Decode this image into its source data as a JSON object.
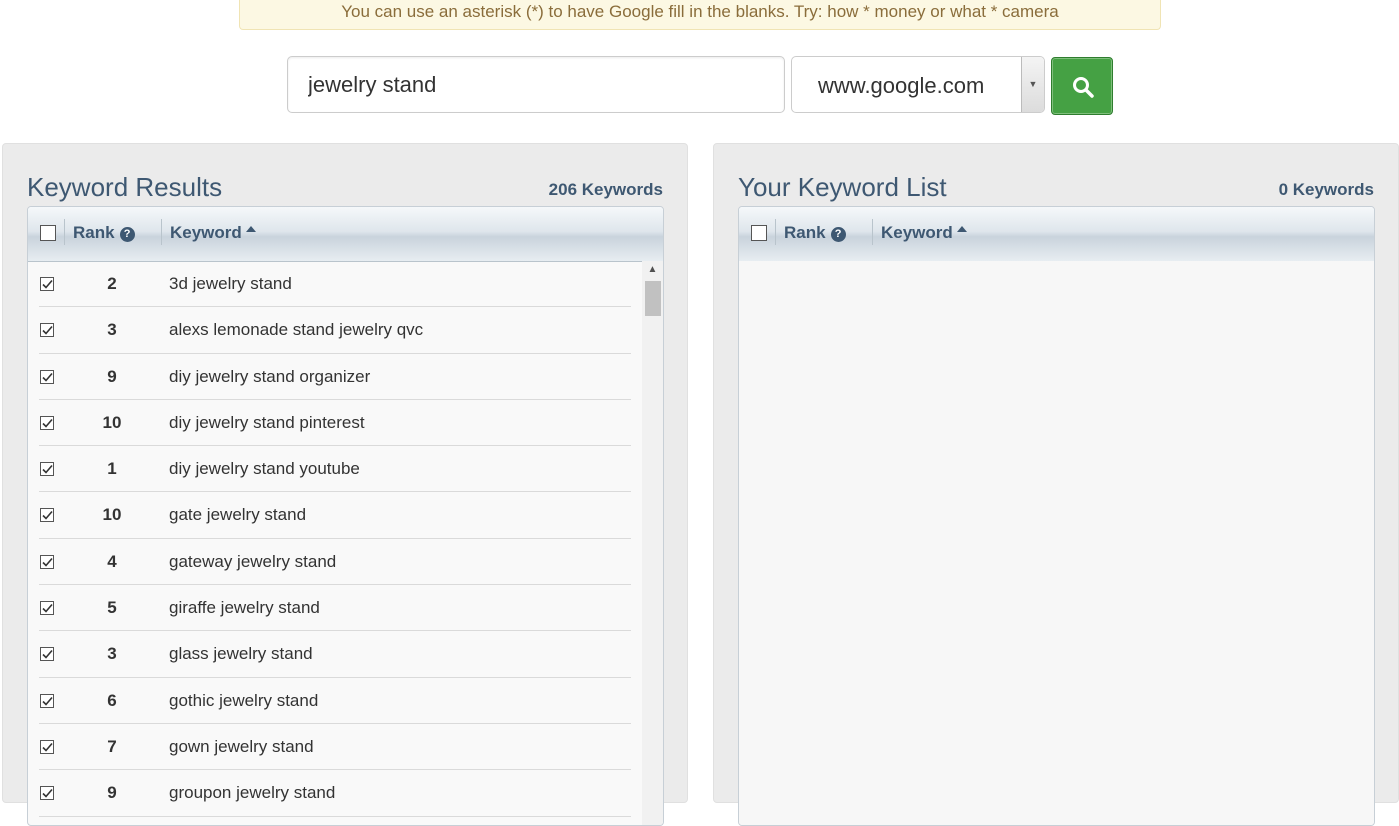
{
  "tip": {
    "text": "You can use an asterisk (*) to have Google fill in the blanks. Try: how * money or what * camera"
  },
  "search": {
    "value": "jewelry stand",
    "domain": "www.google.com"
  },
  "results": {
    "title": "Keyword Results",
    "count": "206 Keywords",
    "col_rank": "Rank",
    "col_keyword": "Keyword",
    "rows": [
      {
        "rank": "2",
        "keyword": "3d jewelry stand",
        "checked": true
      },
      {
        "rank": "3",
        "keyword": "alexs lemonade stand jewelry qvc",
        "checked": true
      },
      {
        "rank": "9",
        "keyword": "diy jewelry stand organizer",
        "checked": true
      },
      {
        "rank": "10",
        "keyword": "diy jewelry stand pinterest",
        "checked": true
      },
      {
        "rank": "1",
        "keyword": "diy jewelry stand youtube",
        "checked": true
      },
      {
        "rank": "10",
        "keyword": "gate jewelry stand",
        "checked": true
      },
      {
        "rank": "4",
        "keyword": "gateway jewelry stand",
        "checked": true
      },
      {
        "rank": "5",
        "keyword": "giraffe jewelry stand",
        "checked": true
      },
      {
        "rank": "3",
        "keyword": "glass jewelry stand",
        "checked": true
      },
      {
        "rank": "6",
        "keyword": "gothic jewelry stand",
        "checked": true
      },
      {
        "rank": "7",
        "keyword": "gown jewelry stand",
        "checked": true
      },
      {
        "rank": "9",
        "keyword": "groupon jewelry stand",
        "checked": true
      }
    ]
  },
  "list": {
    "title": "Your Keyword List",
    "count": "0 Keywords",
    "col_rank": "Rank",
    "col_keyword": "Keyword"
  },
  "icons": {
    "search": "magnifier-icon",
    "help": "question-circle-icon",
    "sort": "sort-asc-icon",
    "dropdown": "chevron-down-icon",
    "scroll_up": "arrow-up-icon"
  },
  "colors": {
    "accent": "#3e5872",
    "button": "#45a144",
    "tip_bg": "#fcf8e3",
    "tip_text": "#8a6d3b"
  }
}
